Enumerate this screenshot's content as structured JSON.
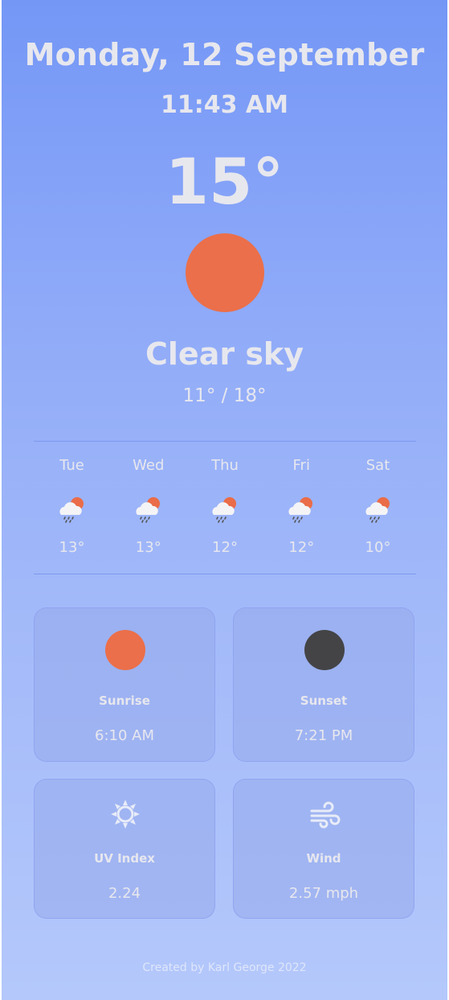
{
  "header": {
    "date": "Monday, 12 September",
    "time": "11:43 AM"
  },
  "current": {
    "temperature": "15°",
    "icon": "sun-icon",
    "description": "Clear sky",
    "range": "11° / 18°"
  },
  "forecast": [
    {
      "day": "Tue",
      "icon": "rain-cloud-sun-icon",
      "temp": "13°"
    },
    {
      "day": "Wed",
      "icon": "rain-cloud-sun-icon",
      "temp": "13°"
    },
    {
      "day": "Thu",
      "icon": "rain-cloud-sun-icon",
      "temp": "12°"
    },
    {
      "day": "Fri",
      "icon": "rain-cloud-sun-icon",
      "temp": "12°"
    },
    {
      "day": "Sat",
      "icon": "rain-cloud-sun-icon",
      "temp": "10°"
    }
  ],
  "details": {
    "sunrise": {
      "label": "Sunrise",
      "value": "6:10 AM",
      "icon": "sunrise-icon"
    },
    "sunset": {
      "label": "Sunset",
      "value": "7:21 PM",
      "icon": "sunset-icon"
    },
    "uv": {
      "label": "UV Index",
      "value": "2.24",
      "icon": "sun-outline-icon"
    },
    "wind": {
      "label": "Wind",
      "value": "2.57 mph",
      "icon": "wind-icon"
    }
  },
  "footer": {
    "credit": "Created by Karl George 2022"
  },
  "colors": {
    "sun": "#eb6f4a",
    "sunset": "#444446",
    "text": "#e7e7ee",
    "gradient_top": "#7497f6",
    "gradient_bottom": "#b4c8fb"
  }
}
